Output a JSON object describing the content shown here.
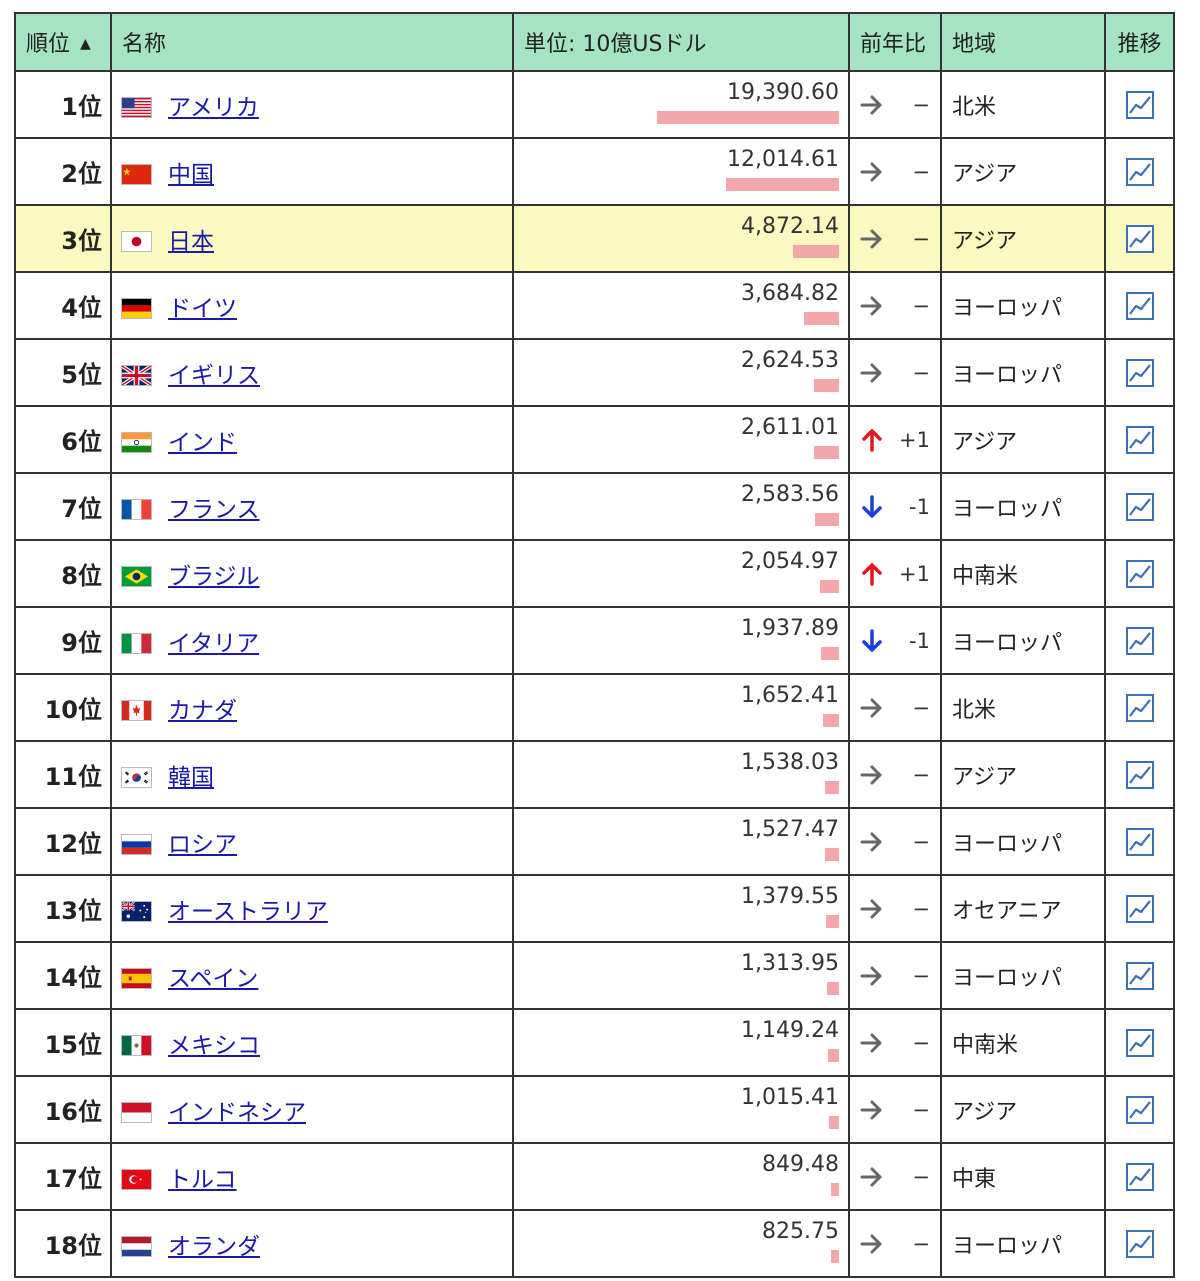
{
  "header": {
    "rank": "順位",
    "rank_sort_icon": "sort-ascending-icon",
    "name": "名称",
    "value": "単位: 10億USドル",
    "change": "前年比",
    "region": "地域",
    "trend": "推移"
  },
  "colors": {
    "header_bg": "#a6e3c2",
    "highlight_bg": "#fbf8c0",
    "bar": "#f4a7ab",
    "link": "#1a1aa6",
    "up_arrow": "#e8141c",
    "down_arrow": "#1a3fd6",
    "flat_arrow": "#666666"
  },
  "rows": [
    {
      "rank": "1位",
      "flag": "us",
      "name": "アメリカ",
      "value": "19,390.60",
      "amount": 19390.6,
      "trend": "flat",
      "change": "−",
      "region": "北米"
    },
    {
      "rank": "2位",
      "flag": "cn",
      "name": "中国",
      "value": "12,014.61",
      "amount": 12014.61,
      "trend": "flat",
      "change": "−",
      "region": "アジア"
    },
    {
      "rank": "3位",
      "flag": "jp",
      "name": "日本",
      "value": "4,872.14",
      "amount": 4872.14,
      "trend": "flat",
      "change": "−",
      "region": "アジア",
      "highlight": true
    },
    {
      "rank": "4位",
      "flag": "de",
      "name": "ドイツ",
      "value": "3,684.82",
      "amount": 3684.82,
      "trend": "flat",
      "change": "−",
      "region": "ヨーロッパ"
    },
    {
      "rank": "5位",
      "flag": "gb",
      "name": "イギリス",
      "value": "2,624.53",
      "amount": 2624.53,
      "trend": "flat",
      "change": "−",
      "region": "ヨーロッパ"
    },
    {
      "rank": "6位",
      "flag": "in",
      "name": "インド",
      "value": "2,611.01",
      "amount": 2611.01,
      "trend": "up",
      "change": "+1",
      "region": "アジア"
    },
    {
      "rank": "7位",
      "flag": "fr",
      "name": "フランス",
      "value": "2,583.56",
      "amount": 2583.56,
      "trend": "down",
      "change": "-1",
      "region": "ヨーロッパ"
    },
    {
      "rank": "8位",
      "flag": "br",
      "name": "ブラジル",
      "value": "2,054.97",
      "amount": 2054.97,
      "trend": "up",
      "change": "+1",
      "region": "中南米"
    },
    {
      "rank": "9位",
      "flag": "it",
      "name": "イタリア",
      "value": "1,937.89",
      "amount": 1937.89,
      "trend": "down",
      "change": "-1",
      "region": "ヨーロッパ"
    },
    {
      "rank": "10位",
      "flag": "ca",
      "name": "カナダ",
      "value": "1,652.41",
      "amount": 1652.41,
      "trend": "flat",
      "change": "−",
      "region": "北米"
    },
    {
      "rank": "11位",
      "flag": "kr",
      "name": "韓国",
      "value": "1,538.03",
      "amount": 1538.03,
      "trend": "flat",
      "change": "−",
      "region": "アジア"
    },
    {
      "rank": "12位",
      "flag": "ru",
      "name": "ロシア",
      "value": "1,527.47",
      "amount": 1527.47,
      "trend": "flat",
      "change": "−",
      "region": "ヨーロッパ"
    },
    {
      "rank": "13位",
      "flag": "au",
      "name": "オーストラリア",
      "value": "1,379.55",
      "amount": 1379.55,
      "trend": "flat",
      "change": "−",
      "region": "オセアニア"
    },
    {
      "rank": "14位",
      "flag": "es",
      "name": "スペイン",
      "value": "1,313.95",
      "amount": 1313.95,
      "trend": "flat",
      "change": "−",
      "region": "ヨーロッパ"
    },
    {
      "rank": "15位",
      "flag": "mx",
      "name": "メキシコ",
      "value": "1,149.24",
      "amount": 1149.24,
      "trend": "flat",
      "change": "−",
      "region": "中南米"
    },
    {
      "rank": "16位",
      "flag": "id",
      "name": "インドネシア",
      "value": "1,015.41",
      "amount": 1015.41,
      "trend": "flat",
      "change": "−",
      "region": "アジア"
    },
    {
      "rank": "17位",
      "flag": "tr",
      "name": "トルコ",
      "value": "849.48",
      "amount": 849.48,
      "trend": "flat",
      "change": "−",
      "region": "中東"
    },
    {
      "rank": "18位",
      "flag": "nl",
      "name": "オランダ",
      "value": "825.75",
      "amount": 825.75,
      "trend": "flat",
      "change": "−",
      "region": "ヨーロッパ"
    }
  ]
}
